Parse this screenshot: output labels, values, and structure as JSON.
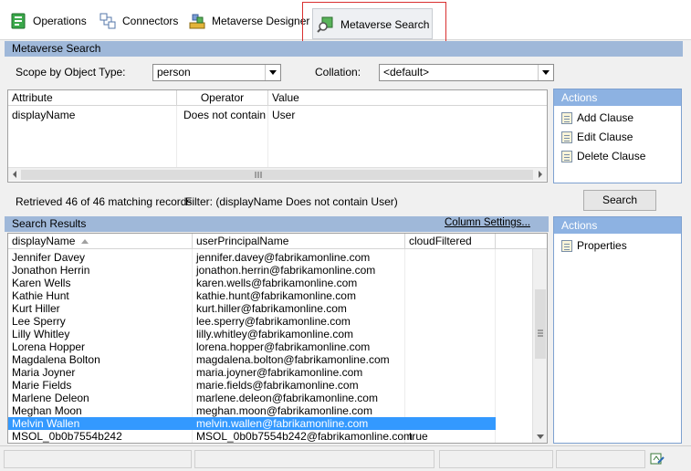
{
  "toolbar": {
    "operations": "Operations",
    "connectors": "Connectors",
    "metaverse_designer": "Metaverse Designer",
    "metaverse_search": "Metaverse Search"
  },
  "search_panel": {
    "title": "Metaverse Search",
    "scope_label": "Scope by Object Type:",
    "scope_value": "person",
    "collation_label": "Collation:",
    "collation_value": "<default>"
  },
  "clause_grid": {
    "headers": [
      "Attribute",
      "Operator",
      "Value"
    ],
    "rows": [
      {
        "attribute": "displayName",
        "operator": "Does not contain",
        "value": "User"
      }
    ]
  },
  "clause_actions": {
    "title": "Actions",
    "items": [
      "Add Clause",
      "Edit Clause",
      "Delete Clause"
    ]
  },
  "status_line": {
    "retrieved": "Retrieved 46 of 46 matching records",
    "filter": "Filter: (displayName Does not contain User)"
  },
  "search_button": "Search",
  "results": {
    "title": "Search Results",
    "column_settings": "Column Settings...",
    "headers": [
      "displayName",
      "userPrincipalName",
      "cloudFiltered"
    ],
    "rows": [
      {
        "name": "Jennifer Davey",
        "upn": "jennifer.davey@fabrikamonline.com",
        "cf": ""
      },
      {
        "name": "Jonathon Herrin",
        "upn": "jonathon.herrin@fabrikamonline.com",
        "cf": ""
      },
      {
        "name": "Karen Wells",
        "upn": "karen.wells@fabrikamonline.com",
        "cf": ""
      },
      {
        "name": "Kathie Hunt",
        "upn": "kathie.hunt@fabrikamonline.com",
        "cf": ""
      },
      {
        "name": "Kurt Hiller",
        "upn": "kurt.hiller@fabrikamonline.com",
        "cf": ""
      },
      {
        "name": "Lee Sperry",
        "upn": "lee.sperry@fabrikamonline.com",
        "cf": ""
      },
      {
        "name": "Lilly Whitley",
        "upn": "lilly.whitley@fabrikamonline.com",
        "cf": ""
      },
      {
        "name": "Lorena Hopper",
        "upn": "lorena.hopper@fabrikamonline.com",
        "cf": ""
      },
      {
        "name": "Magdalena Bolton",
        "upn": "magdalena.bolton@fabrikamonline.com",
        "cf": ""
      },
      {
        "name": "Maria Joyner",
        "upn": "maria.joyner@fabrikamonline.com",
        "cf": ""
      },
      {
        "name": "Marie Fields",
        "upn": "marie.fields@fabrikamonline.com",
        "cf": ""
      },
      {
        "name": "Marlene Deleon",
        "upn": "marlene.deleon@fabrikamonline.com",
        "cf": ""
      },
      {
        "name": "Meghan Moon",
        "upn": "meghan.moon@fabrikamonline.com",
        "cf": ""
      },
      {
        "name": "Melvin Wallen",
        "upn": "melvin.wallen@fabrikamonline.com",
        "cf": ""
      },
      {
        "name": "MSOL_0b0b7554b242",
        "upn": "MSOL_0b0b7554b242@fabrikamonline.com",
        "cf": "true"
      }
    ],
    "selected_index": 13
  },
  "results_actions": {
    "title": "Actions",
    "items": [
      "Properties"
    ]
  },
  "colors": {
    "selection": "#3399ff",
    "panel_header": "#9fb8d9",
    "actions_header": "#8db2e2",
    "highlight_border": "#d93030"
  }
}
